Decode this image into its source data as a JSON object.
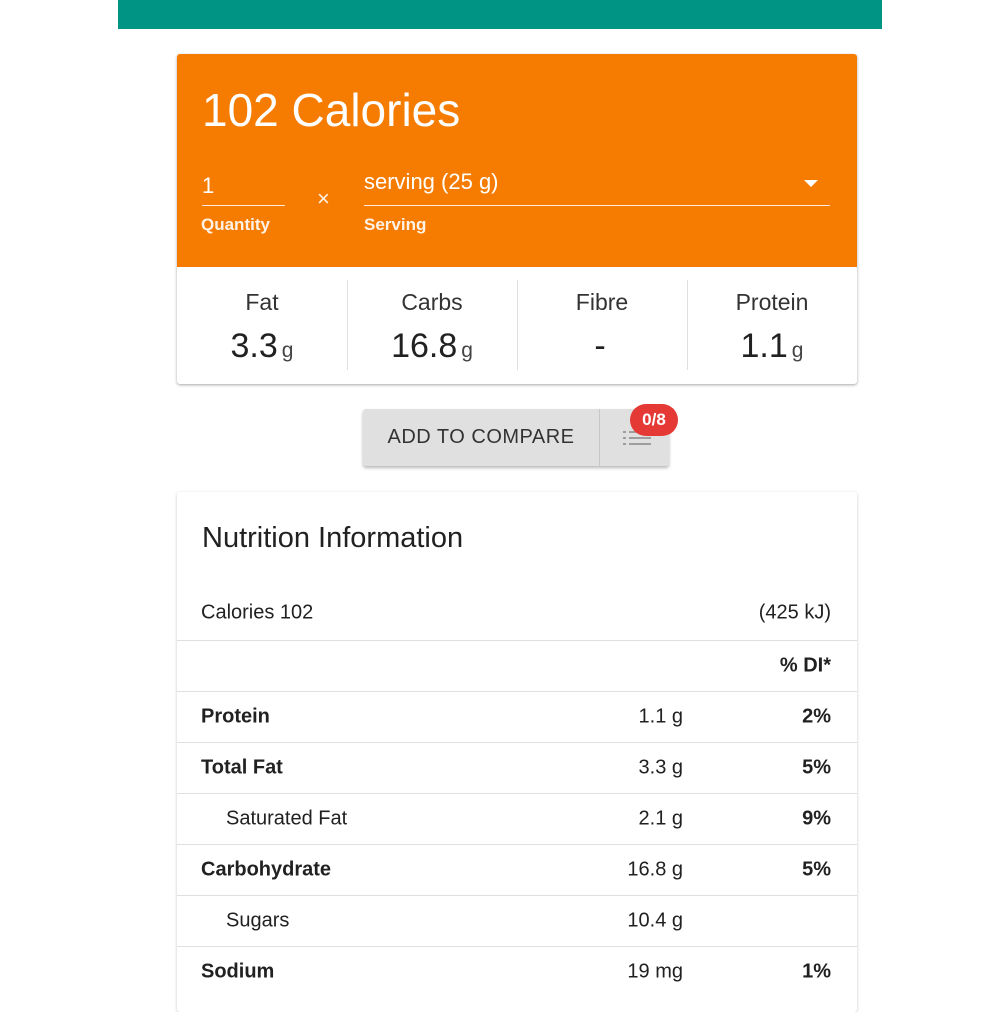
{
  "calorie_card": {
    "title": "102 Calories",
    "quantity": {
      "value": "1",
      "label": "Quantity"
    },
    "times_symbol": "×",
    "serving": {
      "value": "serving (25 g)",
      "label": "Serving"
    },
    "macros": [
      {
        "name": "Fat",
        "value": "3.3",
        "unit": "g"
      },
      {
        "name": "Carbs",
        "value": "16.8",
        "unit": "g"
      },
      {
        "name": "Fibre",
        "value": "-",
        "unit": ""
      },
      {
        "name": "Protein",
        "value": "1.1",
        "unit": "g"
      }
    ]
  },
  "compare": {
    "button_label": "ADD TO COMPARE",
    "badge": "0/8",
    "list_icon": "list-icon"
  },
  "nutrition": {
    "title": "Nutrition Information",
    "calories_label": "Calories 102",
    "kilojoules": "(425 kJ)",
    "di_header": "% DI*",
    "rows": [
      {
        "name": "Protein",
        "amount": "1.1 g",
        "di": "2%"
      },
      {
        "name": "Total Fat",
        "amount": "3.3 g",
        "di": "5%"
      },
      {
        "name": "Saturated Fat",
        "amount": "2.1 g",
        "di": "9%"
      },
      {
        "name": "Carbohydrate",
        "amount": "16.8 g",
        "di": "5%"
      },
      {
        "name": "Sugars",
        "amount": "10.4 g",
        "di": ""
      },
      {
        "name": "Sodium",
        "amount": "19 mg",
        "di": "1%"
      }
    ]
  },
  "colors": {
    "top_bar": "#009485",
    "calorie_header": "#f57c00",
    "badge": "#e53935"
  }
}
